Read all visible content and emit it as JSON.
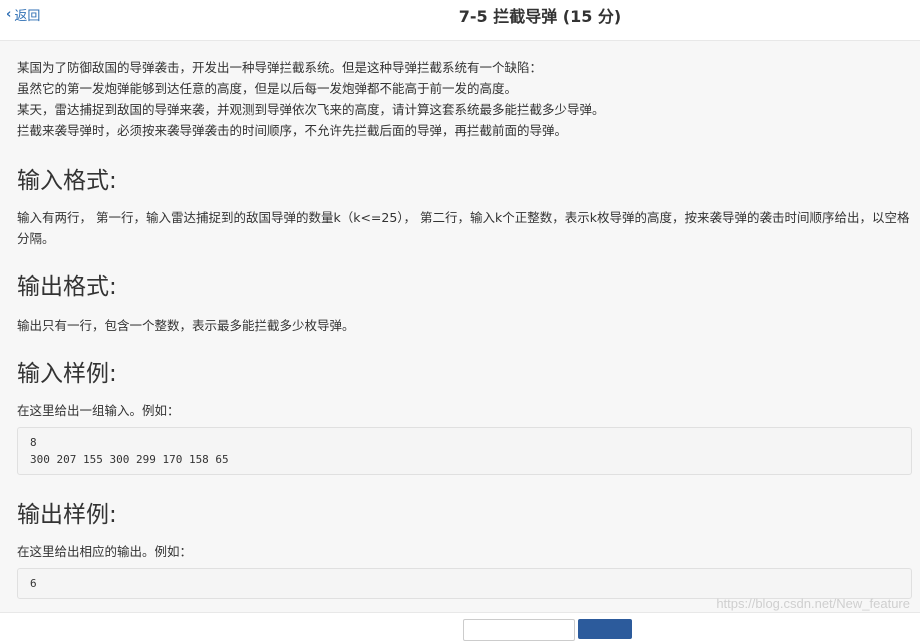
{
  "header": {
    "back_label": "返回",
    "title": "7-5 拦截导弹 (15 分)"
  },
  "problem": {
    "description": [
      "某国为了防御敌国的导弹袭击，开发出一种导弹拦截系统。但是这种导弹拦截系统有一个缺陷：",
      "虽然它的第一发炮弹能够到达任意的高度，但是以后每一发炮弹都不能高于前一发的高度。",
      "某天，雷达捕捉到敌国的导弹来袭，并观测到导弹依次飞来的高度，请计算这套系统最多能拦截多少导弹。",
      "拦截来袭导弹时，必须按来袭导弹袭击的时间顺序，不允许先拦截后面的导弹，再拦截前面的导弹。"
    ],
    "input_heading": "输入格式:",
    "input_text": "输入有两行， 第一行，输入雷达捕捉到的敌国导弹的数量k（k<=25）， 第二行，输入k个正整数，表示k枚导弹的高度，按来袭导弹的袭击时间顺序给出，以空格分隔。",
    "output_heading": "输出格式:",
    "output_text": "输出只有一行，包含一个整数，表示最多能拦截多少枚导弹。",
    "sample_input_heading": "输入样例:",
    "sample_input_note": "在这里给出一组输入。例如：",
    "sample_input_lines": [
      "8",
      "300 207 155 300 299 170 158 65"
    ],
    "sample_output_heading": "输出样例:",
    "sample_output_note": "在这里给出相应的输出。例如：",
    "sample_output_lines": [
      "6"
    ]
  },
  "watermark": "https://blog.csdn.net/New_feature"
}
